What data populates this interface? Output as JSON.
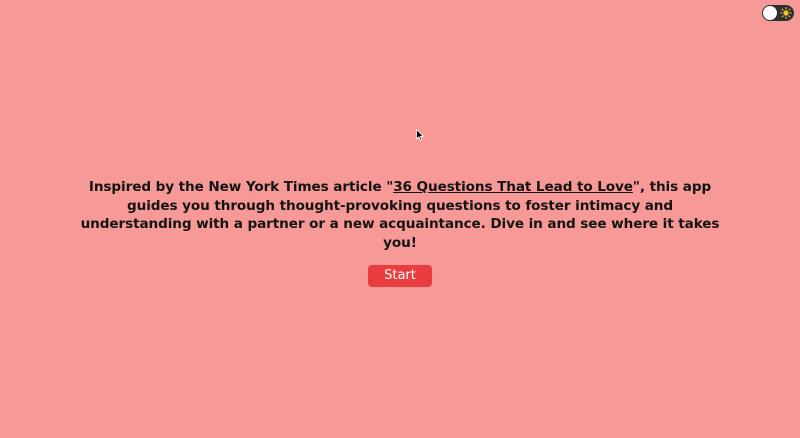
{
  "theme_toggle": {
    "icon": "sun-icon",
    "state": "light"
  },
  "intro": {
    "text_before": "Inspired by the New York Times article \"",
    "link_text": "36 Questions That Lead to Love",
    "text_after": "\", this app guides you through thought-provoking questions to foster intimacy and understanding with a partner or a new acquaintance. Dive in and see where it takes you!"
  },
  "start_button": {
    "label": "Start"
  },
  "colors": {
    "background": "#f79996",
    "accent": "#e93d3f",
    "text": "#141414",
    "toggle_track": "#2f2f33",
    "sun": "#f5c518"
  }
}
